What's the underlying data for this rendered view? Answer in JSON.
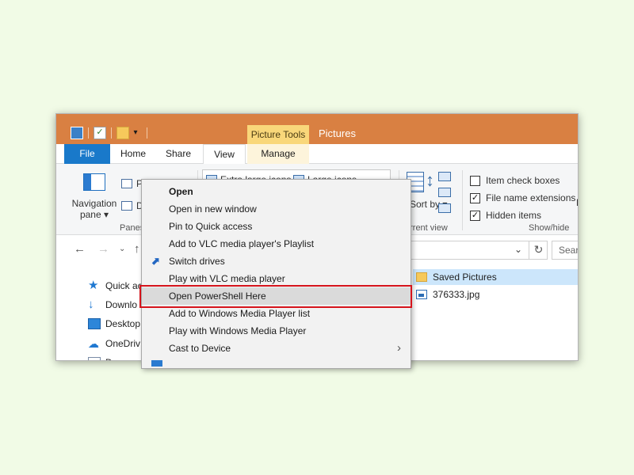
{
  "window": {
    "title": "Pictures",
    "contextual_tab_group": "Picture Tools"
  },
  "ribbon_tabs": [
    {
      "label": "File"
    },
    {
      "label": "Home"
    },
    {
      "label": "Share"
    },
    {
      "label": "View"
    },
    {
      "label": "Manage"
    }
  ],
  "ribbon": {
    "navigation_pane_label": "Navigation pane",
    "preview_label": "P",
    "details_label": "D",
    "panes_group": "Panes",
    "layout_items": [
      "Extra large icons",
      "Large icons"
    ],
    "sort_label": "Sort by",
    "current_view_group": "urrent view",
    "item_check_boxes": "Item check boxes",
    "file_name_extensions": "File name extensions",
    "hidden_items": "Hidden items",
    "show_hide_group": "Show/hide",
    "cut_letter": "F"
  },
  "address": {
    "search_placeholder": "Searc"
  },
  "nav_pane": [
    {
      "label": "Quick acce",
      "icon": "star-icon"
    },
    {
      "label": "Downlo",
      "icon": "download-icon"
    },
    {
      "label": "Desktop",
      "icon": "desktop-icon"
    },
    {
      "label": "OneDriv",
      "icon": "onedrive-icon"
    },
    {
      "label": "D",
      "icon": "documents-icon"
    }
  ],
  "files": [
    {
      "name": "Saved Pictures",
      "type": "folder"
    },
    {
      "name": "376333.jpg",
      "type": "image"
    }
  ],
  "context_menu": [
    {
      "label": "Open",
      "bold": true
    },
    {
      "label": "Open in new window"
    },
    {
      "label": "Pin to Quick access"
    },
    {
      "label": "Add to VLC media player's Playlist"
    },
    {
      "label": "Switch drives",
      "icon": "switch-drives-icon"
    },
    {
      "label": "Play with VLC media player"
    },
    {
      "label": "Open PowerShell Here",
      "highlighted": true
    },
    {
      "label": "Add to Windows Media Player list"
    },
    {
      "label": "Play with Windows Media Player"
    },
    {
      "label": "Cast to Device",
      "submenu": true
    }
  ],
  "colors": {
    "titlebar": "#d98042",
    "file_tab": "#1979ca",
    "picture_tools": "#f9d77a",
    "highlight_border": "#d6141c",
    "background": "#f1fbe6"
  }
}
